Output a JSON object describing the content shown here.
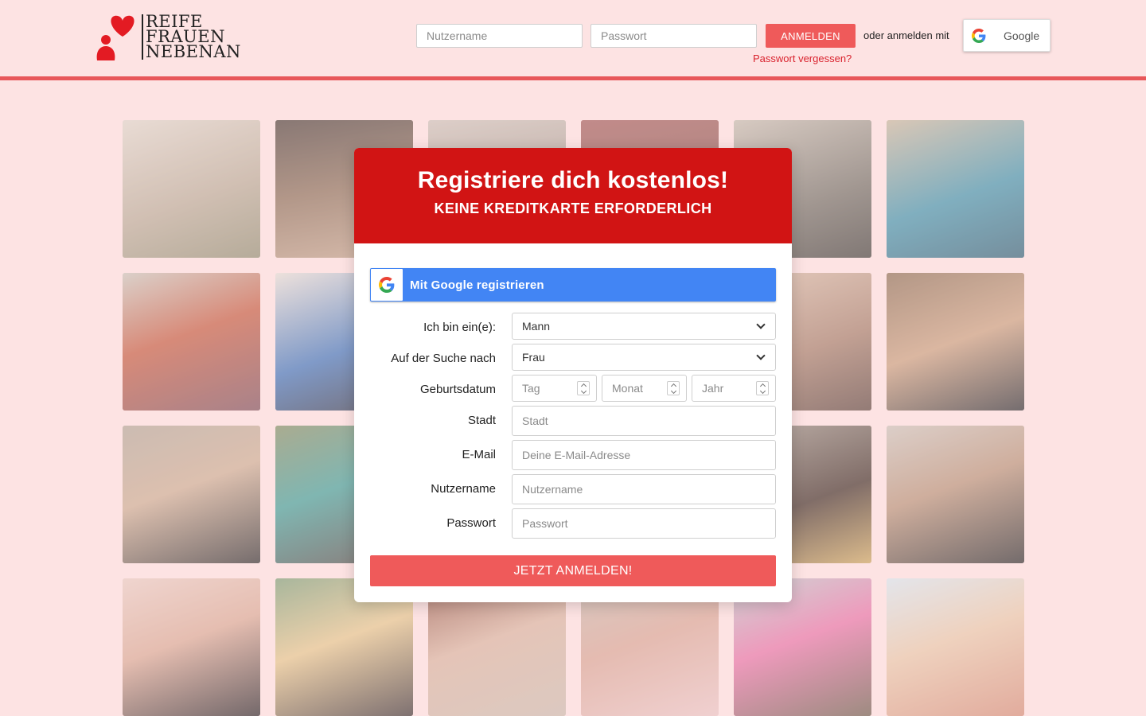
{
  "brand": {
    "logo_lines": [
      "REIFE",
      "FRAUEN",
      "NEBENAN"
    ],
    "accent": "#d11414",
    "button_color": "#ef5a5a",
    "background": "#fde3e3"
  },
  "header": {
    "username_placeholder": "Nutzername",
    "password_placeholder": "Passwort",
    "login_label": "ANMELDEN",
    "forgot_label": "Passwort vergessen?",
    "or_label": "oder anmelden mit",
    "google_label": "Google"
  },
  "modal": {
    "title": "Registriere dich kostenlos!",
    "subtitle": "KEINE KREDITKARTE ERFORDERLICH",
    "google_register_label": "Mit Google registrieren",
    "gender_label": "Ich bin ein(e):",
    "gender_value": "Mann",
    "seeking_label": "Auf der Suche nach",
    "seeking_value": "Frau",
    "birthdate_label": "Geburtsdatum",
    "day_placeholder": "Tag",
    "month_placeholder": "Monat",
    "year_placeholder": "Jahr",
    "city_label": "Stadt",
    "city_placeholder": "Stadt",
    "email_label": "E-Mail",
    "email_placeholder": "Deine E-Mail-Adresse",
    "username_label": "Nutzername",
    "username_placeholder": "Nutzername",
    "password_label": "Passwort",
    "password_placeholder": "Passwort",
    "submit_label": "JETZT ANMELDEN!"
  },
  "icons": [
    "heart-person-logo-icon",
    "google-icon",
    "chevron-down-icon",
    "spinner-icon"
  ]
}
